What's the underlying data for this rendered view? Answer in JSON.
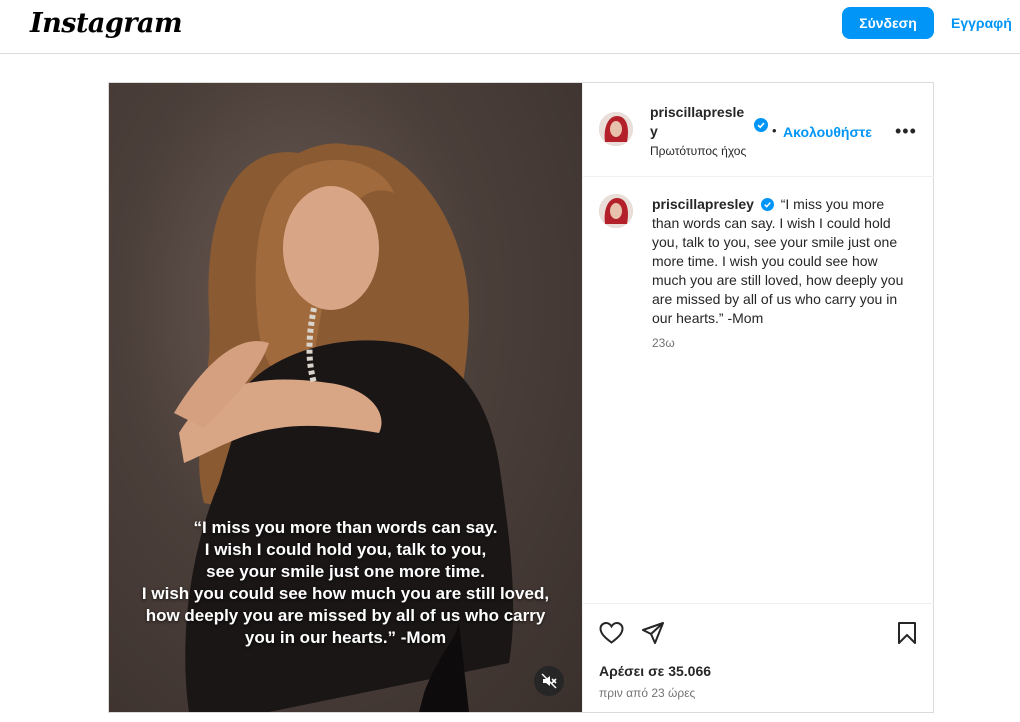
{
  "topbar": {
    "logo": "Instagram",
    "login_label": "Σύνδεση",
    "signup_label": "Εγγραφή"
  },
  "post": {
    "media": {
      "overlay_lines": [
        "“I miss you more than words can say.",
        "I wish I could hold you, talk to you,",
        "see your smile just one more time.",
        "I wish you could see how much you are still loved,",
        "how deeply you are missed by all of us who carry",
        "you in our hearts.” -Mom"
      ]
    },
    "header": {
      "username": "priscillapresley",
      "dot": "•",
      "follow_label": "Ακολουθήστε",
      "more_label": "•••",
      "audio_label": "Πρωτότυπος ήχος"
    },
    "caption": {
      "username": "priscillapresley",
      "text": "“I miss you more than words can say. I wish I could hold you, talk to you, see your smile just one more time. I wish you could see how much you are still loved, how deeply you are missed by all of us who carry you in our hearts.” -Mom",
      "time_ago": "23ω"
    },
    "footer": {
      "likes": "Αρέσει σε 35.066",
      "date": "πριν από 23 ώρες"
    }
  },
  "colors": {
    "accent": "#0095f6",
    "text": "#262626",
    "muted": "#737373",
    "border": "#dbdbdb"
  }
}
